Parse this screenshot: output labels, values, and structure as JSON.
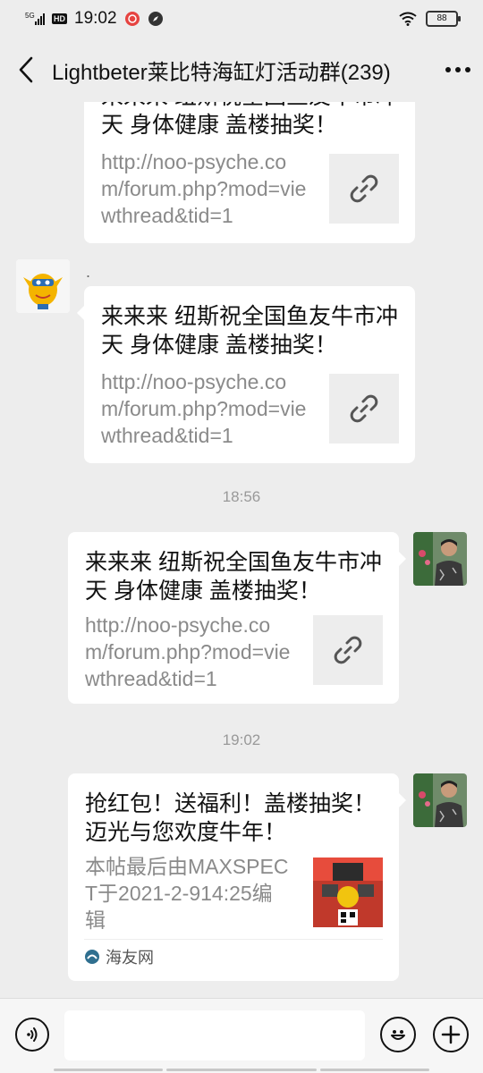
{
  "status_bar": {
    "network": "5G",
    "hd": "HD",
    "time": "19:02",
    "battery": "88"
  },
  "header": {
    "title": "Lightbeter莱比特海缸灯活动群(239)"
  },
  "messages": [
    {
      "title": "来来来 纽斯祝全国鱼友牛市冲天 身体健康 盖楼抽奖！",
      "desc": "http://noo-psyche.com/forum.php?mod=viewthread&tid=1"
    },
    {
      "sender": ".",
      "title": "来来来 纽斯祝全国鱼友牛市冲天 身体健康 盖楼抽奖！",
      "desc": "http://noo-psyche.com/forum.php?mod=viewthread&tid=1"
    },
    {
      "time": "18:56",
      "title": "来来来 纽斯祝全国鱼友牛市冲天 身体健康 盖楼抽奖！",
      "desc": "http://noo-psyche.com/forum.php?mod=viewthread&tid=1"
    },
    {
      "time": "19:02",
      "title": "抢红包！送福利！盖楼抽奖！迈光与您欢度牛年！",
      "desc": "本帖最后由MAXSPECT于2021-2-914:25编辑",
      "source": "海友网"
    }
  ],
  "input": {
    "placeholder": ""
  },
  "icons": {
    "back": "chevron-left-icon",
    "more": "more-dots-icon",
    "link": "link-icon",
    "voice": "voice-icon",
    "emoji": "emoji-icon",
    "add": "plus-icon"
  }
}
